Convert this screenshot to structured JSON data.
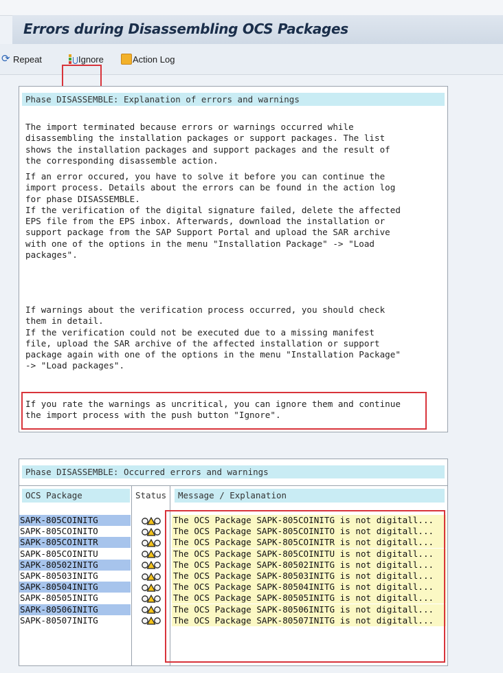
{
  "title": "Errors during Disassembling OCS Packages",
  "toolbar": {
    "repeat": "Repeat",
    "ignore": "Ignore",
    "action_log": "Action Log"
  },
  "explanation": {
    "header": "Phase DISASSEMBLE: Explanation of errors and warnings",
    "paragraphs": [
      "The import terminated because errors or warnings occurred while\ndisassembling the installation packages or support packages. The list\nshows the installation packages and support packages and the result of\nthe corresponding disassemble action.",
      "If an error occured, you have to solve it before you can continue the\nimport process. Details about the errors can be found in the action log\nfor phase DISASSEMBLE.\nIf the verification of the digital signature failed, delete the affected\nEPS file from the EPS inbox. Afterwards, download the installation or\nsupport package from the SAP Support Portal and upload the SAR archive\nwith one of the options in the menu \"Installation Package\" -> \"Load\npackages\".",
      "If warnings about the verification process occurred, you should check\nthem in detail.\nIf the verification could not be executed due to a missing manifest\nfile, upload the SAR archive of the affected installation or support\npackage again with one of the options in the menu \"Installation Package\"\n-> \"Load packages\".",
      "If you rate the warnings as uncritical, you can ignore them and continue\nthe import process with the push button \"Ignore\"."
    ]
  },
  "errors": {
    "header": "Phase DISASSEMBLE: Occurred errors and warnings",
    "columns": [
      "OCS Package",
      "Status",
      "Message / Explanation"
    ],
    "rows": [
      {
        "package": "SAPK-805COINITG",
        "message": "The OCS Package SAPK-805COINITG is not digitall..."
      },
      {
        "package": "SAPK-805COINITO",
        "message": "The OCS Package SAPK-805COINITO is not digitall..."
      },
      {
        "package": "SAPK-805COINITR",
        "message": "The OCS Package SAPK-805COINITR is not digitall..."
      },
      {
        "package": "SAPK-805COINITU",
        "message": "The OCS Package SAPK-805COINITU is not digitall..."
      },
      {
        "package": "SAPK-80502INITG",
        "message": "The OCS Package SAPK-80502INITG is not digitall..."
      },
      {
        "package": "SAPK-80503INITG",
        "message": "The OCS Package SAPK-80503INITG is not digitall..."
      },
      {
        "package": "SAPK-80504INITG",
        "message": "The OCS Package SAPK-80504INITG is not digitall..."
      },
      {
        "package": "SAPK-80505INITG",
        "message": "The OCS Package SAPK-80505INITG is not digitall..."
      },
      {
        "package": "SAPK-80506INITG",
        "message": "The OCS Package SAPK-80506INITG is not digitall..."
      },
      {
        "package": "SAPK-80507INITG",
        "message": "The OCS Package SAPK-80507INITG is not digitall..."
      }
    ],
    "status_icon": "warning-triangles-icon"
  },
  "colors": {
    "highlight_border": "#d8333a",
    "header_bg": "#c9ecf4",
    "row_selected_bg": "#a7c4ec",
    "message_bg": "#fbf8c4"
  }
}
